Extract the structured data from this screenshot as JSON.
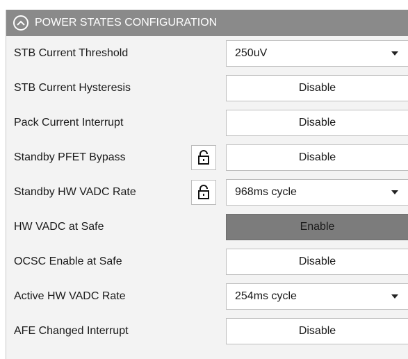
{
  "section": {
    "title": "POWER STATES CONFIGURATION",
    "collapse_icon": "chevron-up-circle-icon"
  },
  "colors": {
    "header_bg": "#8a8a8a",
    "panel_bg": "#f3f3f3",
    "active_button_bg": "#7c7c7c"
  },
  "rows": [
    {
      "label": "STB Current Threshold",
      "type": "select",
      "value": "250uV",
      "lock": false
    },
    {
      "label": "STB Current Hysteresis",
      "type": "button",
      "value": "Disable",
      "lock": false
    },
    {
      "label": "Pack Current Interrupt",
      "type": "button",
      "value": "Disable",
      "lock": false
    },
    {
      "label": "Standby PFET Bypass",
      "type": "button",
      "value": "Disable",
      "lock": true
    },
    {
      "label": "Standby HW VADC Rate",
      "type": "select",
      "value": "968ms cycle",
      "lock": true
    },
    {
      "label": "HW VADC at Safe",
      "type": "button",
      "value": "Enable",
      "lock": false,
      "active": true
    },
    {
      "label": "OCSC Enable at Safe",
      "type": "button",
      "value": "Disable",
      "lock": false
    },
    {
      "label": "Active HW VADC Rate",
      "type": "select",
      "value": "254ms cycle",
      "lock": false
    },
    {
      "label": "AFE Changed Interrupt",
      "type": "button",
      "value": "Disable",
      "lock": false
    }
  ]
}
